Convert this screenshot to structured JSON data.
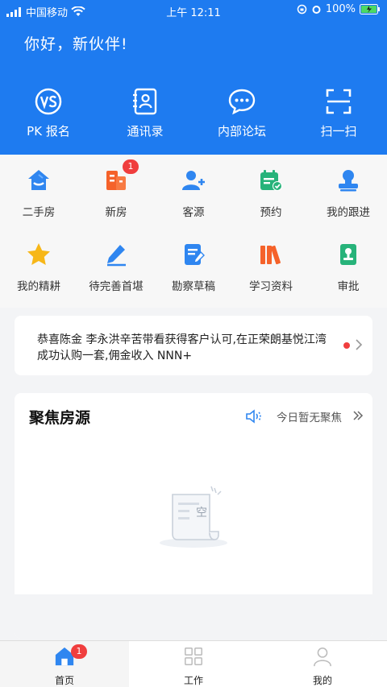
{
  "status_bar": {
    "carrier": "中国移动",
    "time": "上午 12:11",
    "battery": "100%"
  },
  "header": {
    "greeting": "你好，新伙伴!"
  },
  "quick_actions": [
    {
      "label": "PK 报名",
      "icon": "vs-icon"
    },
    {
      "label": "通讯录",
      "icon": "contacts-icon"
    },
    {
      "label": "内部论坛",
      "icon": "chat-icon"
    },
    {
      "label": "扫一扫",
      "icon": "scan-icon"
    }
  ],
  "menu_grid": [
    {
      "label": "二手房",
      "icon": "house-icon"
    },
    {
      "label": "新房",
      "icon": "building-icon",
      "badge": "1"
    },
    {
      "label": "客源",
      "icon": "add-user-icon"
    },
    {
      "label": "预约",
      "icon": "calendar-check-icon"
    },
    {
      "label": "我的跟进",
      "icon": "stamp-icon"
    },
    {
      "label": "我的精耕",
      "icon": "star-icon"
    },
    {
      "label": "待完善首堪",
      "icon": "pencil-icon"
    },
    {
      "label": "勘察草稿",
      "icon": "draft-icon"
    },
    {
      "label": "学习资料",
      "icon": "books-icon"
    },
    {
      "label": "审批",
      "icon": "approval-icon"
    }
  ],
  "notice": {
    "text": "恭喜陈金 李永洪辛苦带看获得客户认可,在正荣朗基悦江湾成功认购一套,佣金收入 NNN+"
  },
  "focus": {
    "title": "聚焦房源",
    "status": "今日暂无聚焦",
    "empty_label": "空"
  },
  "tabs": [
    {
      "label": "首页",
      "icon": "home-icon",
      "badge": "1",
      "active": true
    },
    {
      "label": "工作",
      "icon": "grid-icon"
    },
    {
      "label": "我的",
      "icon": "profile-icon"
    }
  ],
  "colors": {
    "brand_blue": "#1e7bf0",
    "badge_red": "#f03e3e",
    "orange": "#f5622a",
    "green": "#27b37a"
  }
}
